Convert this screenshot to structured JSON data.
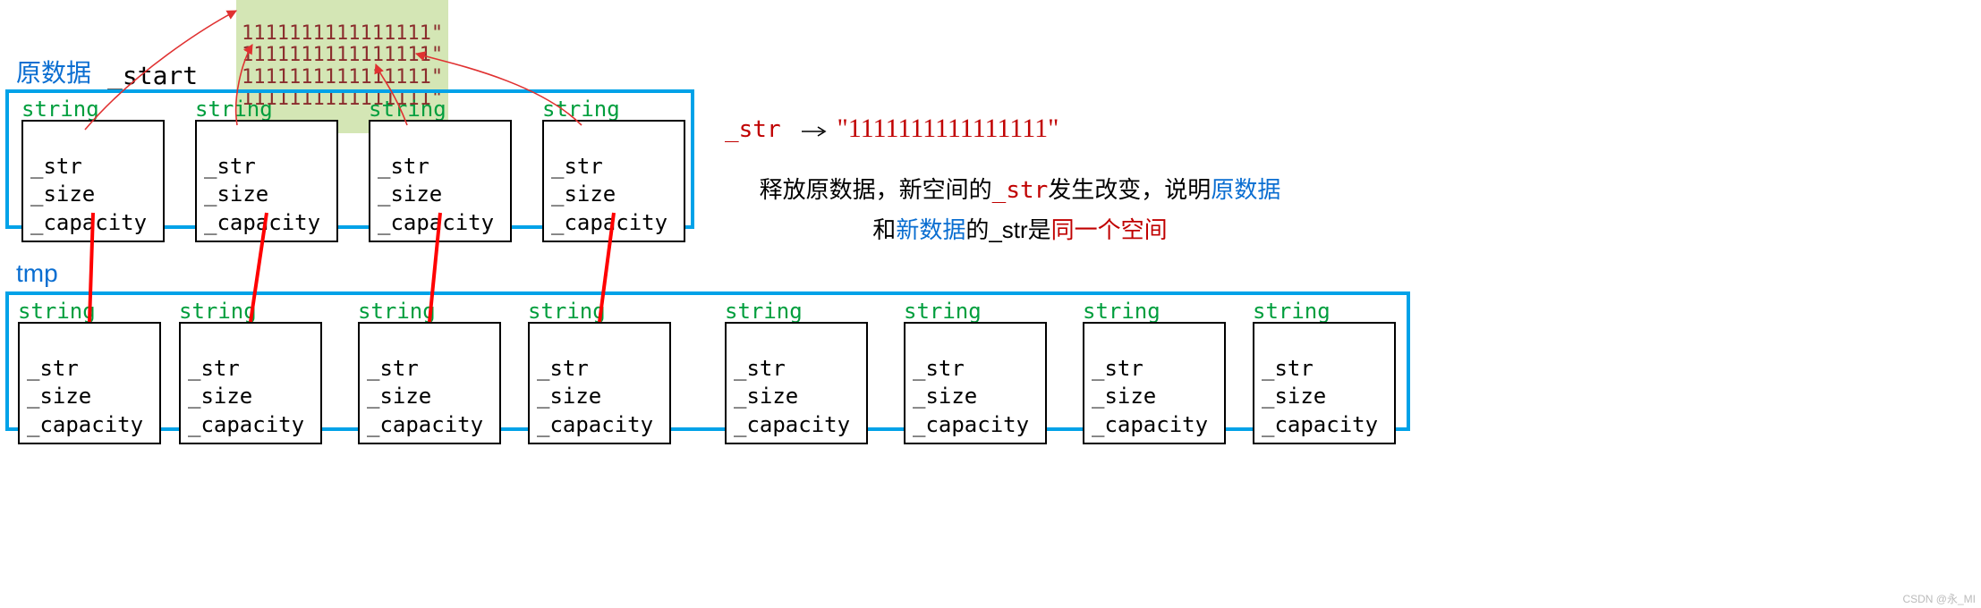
{
  "labels": {
    "original_data": "原数据",
    "start_var": "_start",
    "tmp": "tmp",
    "string_type": "string"
  },
  "heap_lines": [
    "1111111111111111\"",
    "1111111111111111\"",
    "1111111111111111\"",
    "1111111111111111\""
  ],
  "string_fields": {
    "f1": "_str",
    "f2": "_size",
    "f3": "_capacity"
  },
  "right": {
    "ptr_label": "_str",
    "ptr_target": "\"1111111111111111\"",
    "line1_a": "释放原数据，新空间的",
    "line1_b": "_str",
    "line1_c": "发生改变，说明",
    "line1_d": "原数据",
    "line2_a": "和",
    "line2_b": "新数据",
    "line2_c": "的_str是",
    "line2_d": "同一个空间"
  },
  "watermark": "CSDN @永_MI",
  "layout": {
    "top_count": 4,
    "bottom_count": 8
  }
}
